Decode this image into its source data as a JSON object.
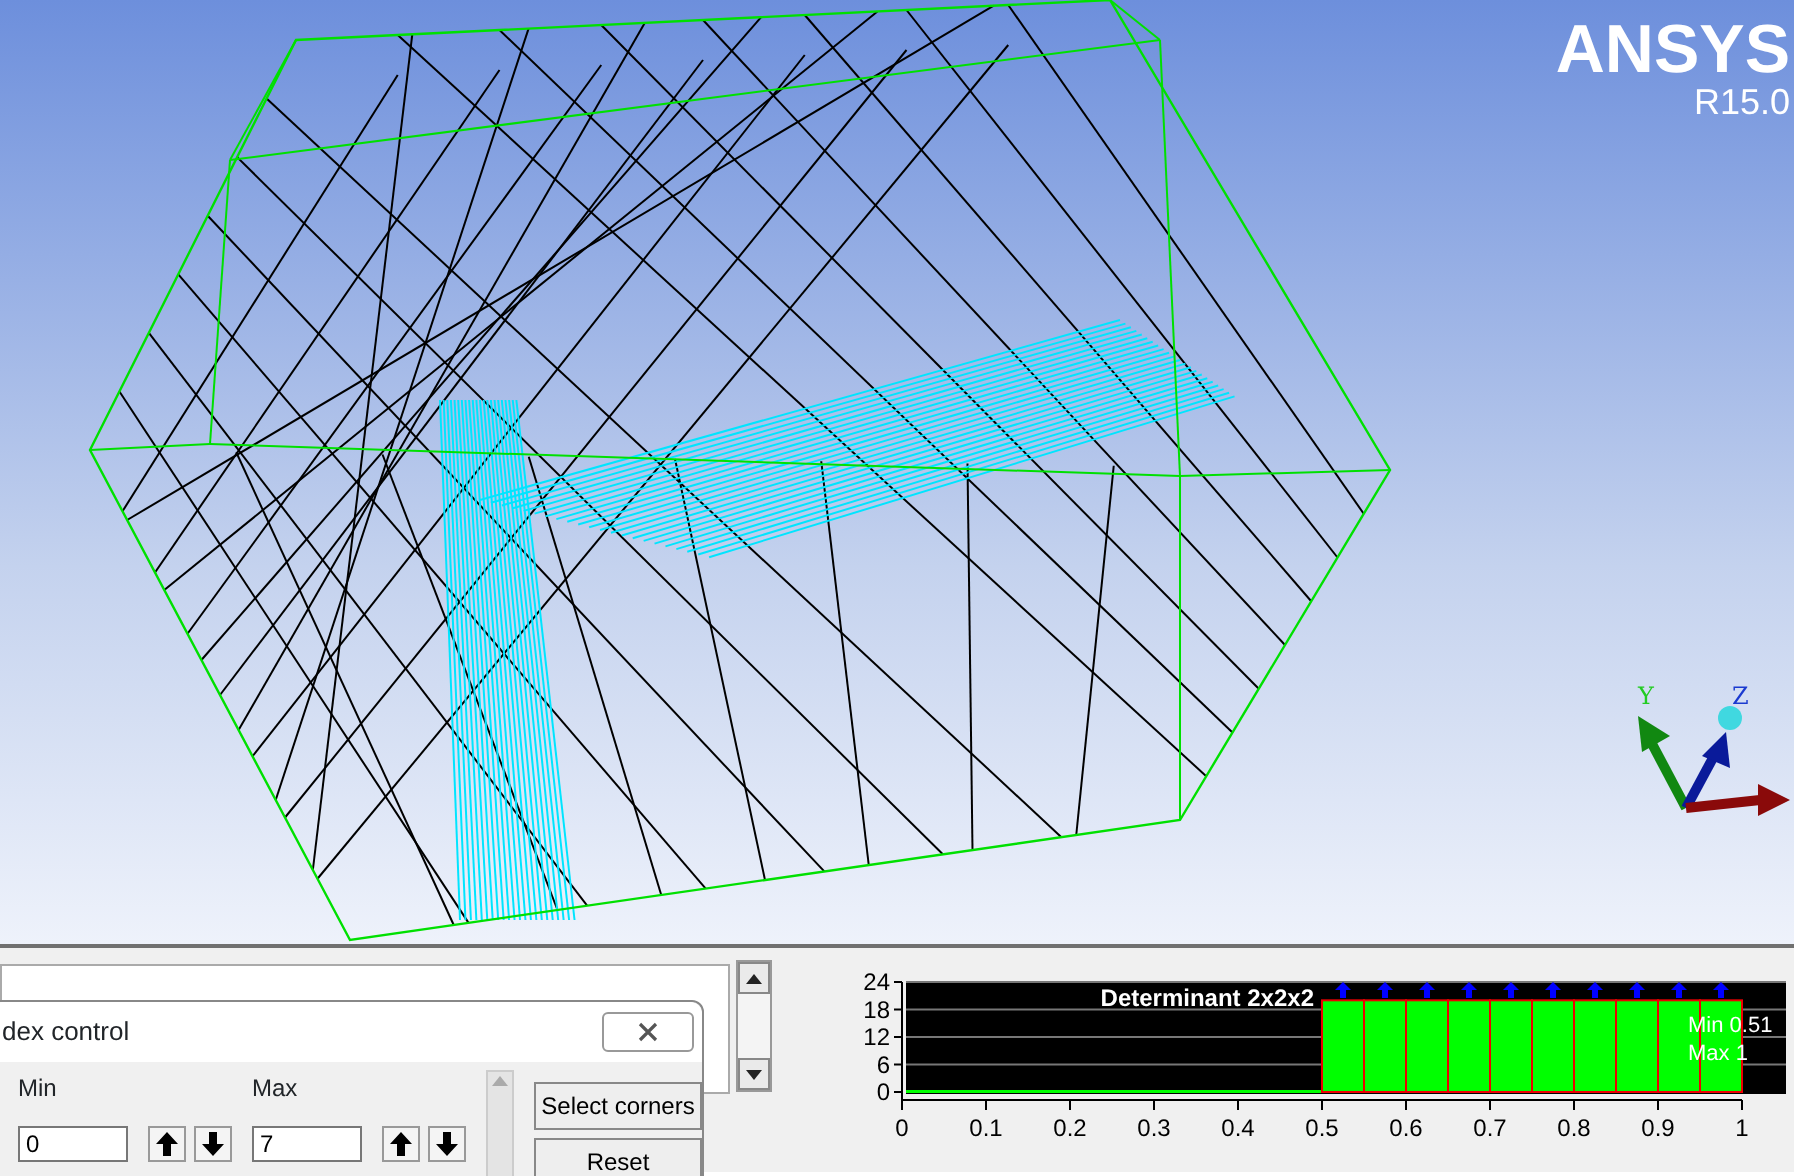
{
  "viewport": {
    "logo": "ANSYS",
    "version": "R15.0",
    "axes": {
      "y_label": "Y",
      "z_label": "Z"
    }
  },
  "dialog": {
    "title": "dex control",
    "columns": [
      "Min",
      "Max"
    ],
    "rows": [
      {
        "min": "0",
        "max": "7"
      }
    ],
    "buttons": [
      "Select corners",
      "Reset"
    ]
  },
  "histogram": {
    "title": "Determinant 2x2x2",
    "min_label": "Min 0.51",
    "max_label": "Max 1",
    "chart_data": {
      "type": "bar",
      "grid": true,
      "x": [
        0.525,
        0.575,
        0.625,
        0.675,
        0.725,
        0.775,
        0.825,
        0.875,
        0.925,
        0.975
      ],
      "values": [
        20,
        20,
        20,
        20,
        20,
        20,
        20,
        20,
        20,
        20
      ],
      "xlim": [
        0,
        1
      ],
      "ylim": [
        0,
        24
      ],
      "xticks": [
        0,
        0.1,
        0.2,
        0.3,
        0.4,
        0.5,
        0.6,
        0.7,
        0.8,
        0.9,
        1
      ],
      "yticks": [
        0,
        6,
        12,
        18,
        24
      ]
    }
  }
}
